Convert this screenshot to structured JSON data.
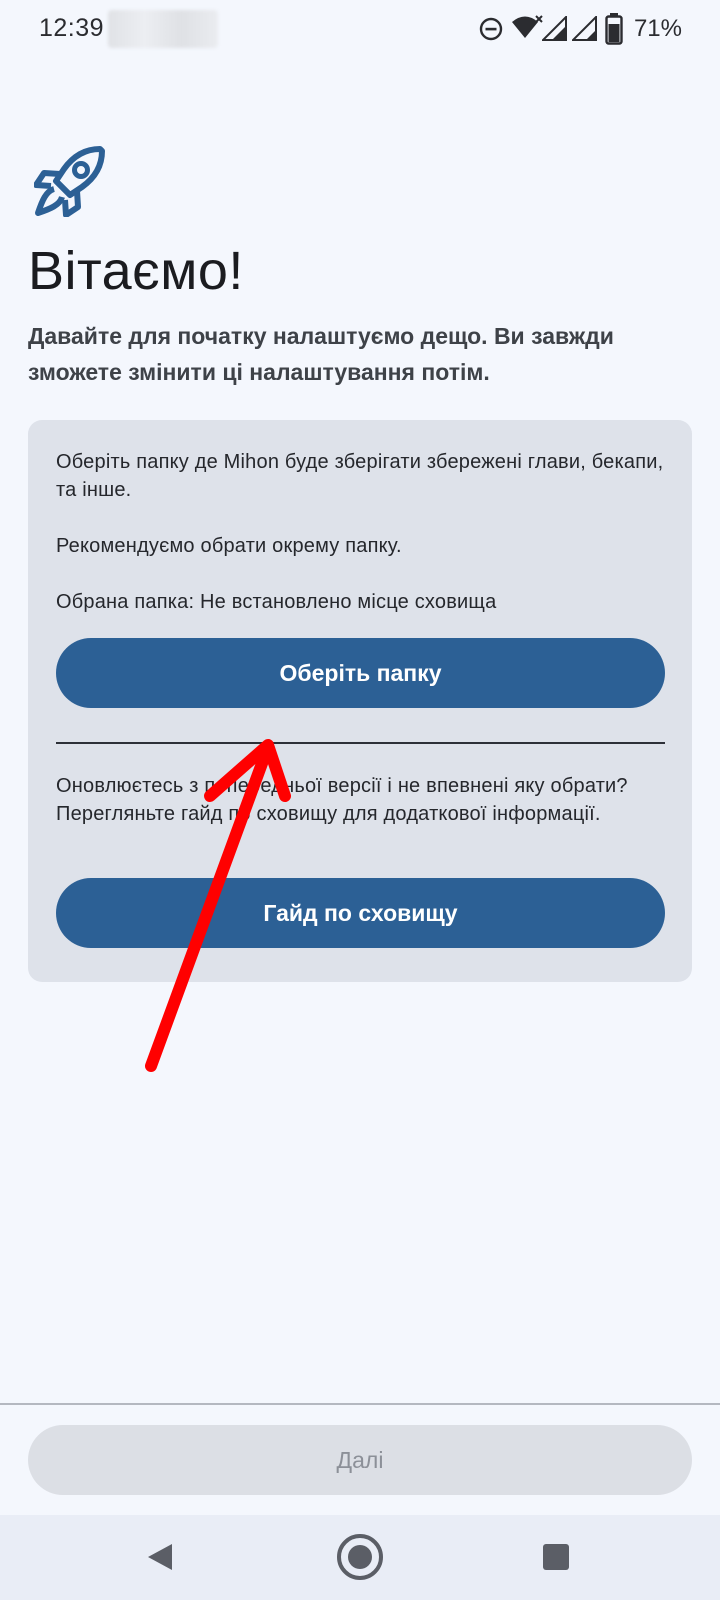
{
  "status_bar": {
    "time": "12:39",
    "battery": "71%",
    "icons": [
      "do-not-disturb-icon",
      "wifi-icon",
      "signal-icon",
      "signal-icon",
      "battery-icon"
    ]
  },
  "header": {
    "icon": "rocket-icon",
    "title": "Вітаємо!",
    "subtitle": "Давайте для початку налаштуємо дещо. Ви завжди зможете змінити ці налаштування потім."
  },
  "storage_card": {
    "description": "Оберіть папку де Mihon буде зберігати збережені глави, бекапи, та інше.",
    "recommendation": "Рекомендуємо обрати окрему папку.",
    "selected_folder": "Обрана папка: Не встановлено місце сховища",
    "choose_folder_button": "Оберіть папку",
    "upgrade_note": "Оновлюєтесь з попередньої версії і не впевнені яку обрати? Перегляньте гайд по сховищу для додаткової інформації.",
    "storage_guide_button": "Гайд по сховищу"
  },
  "footer": {
    "next_button": "Далі"
  },
  "colors": {
    "accent": "#2c6095",
    "background": "#f4f7fd",
    "card": "#dee2ea",
    "annotation_arrow": "#ff0000"
  }
}
